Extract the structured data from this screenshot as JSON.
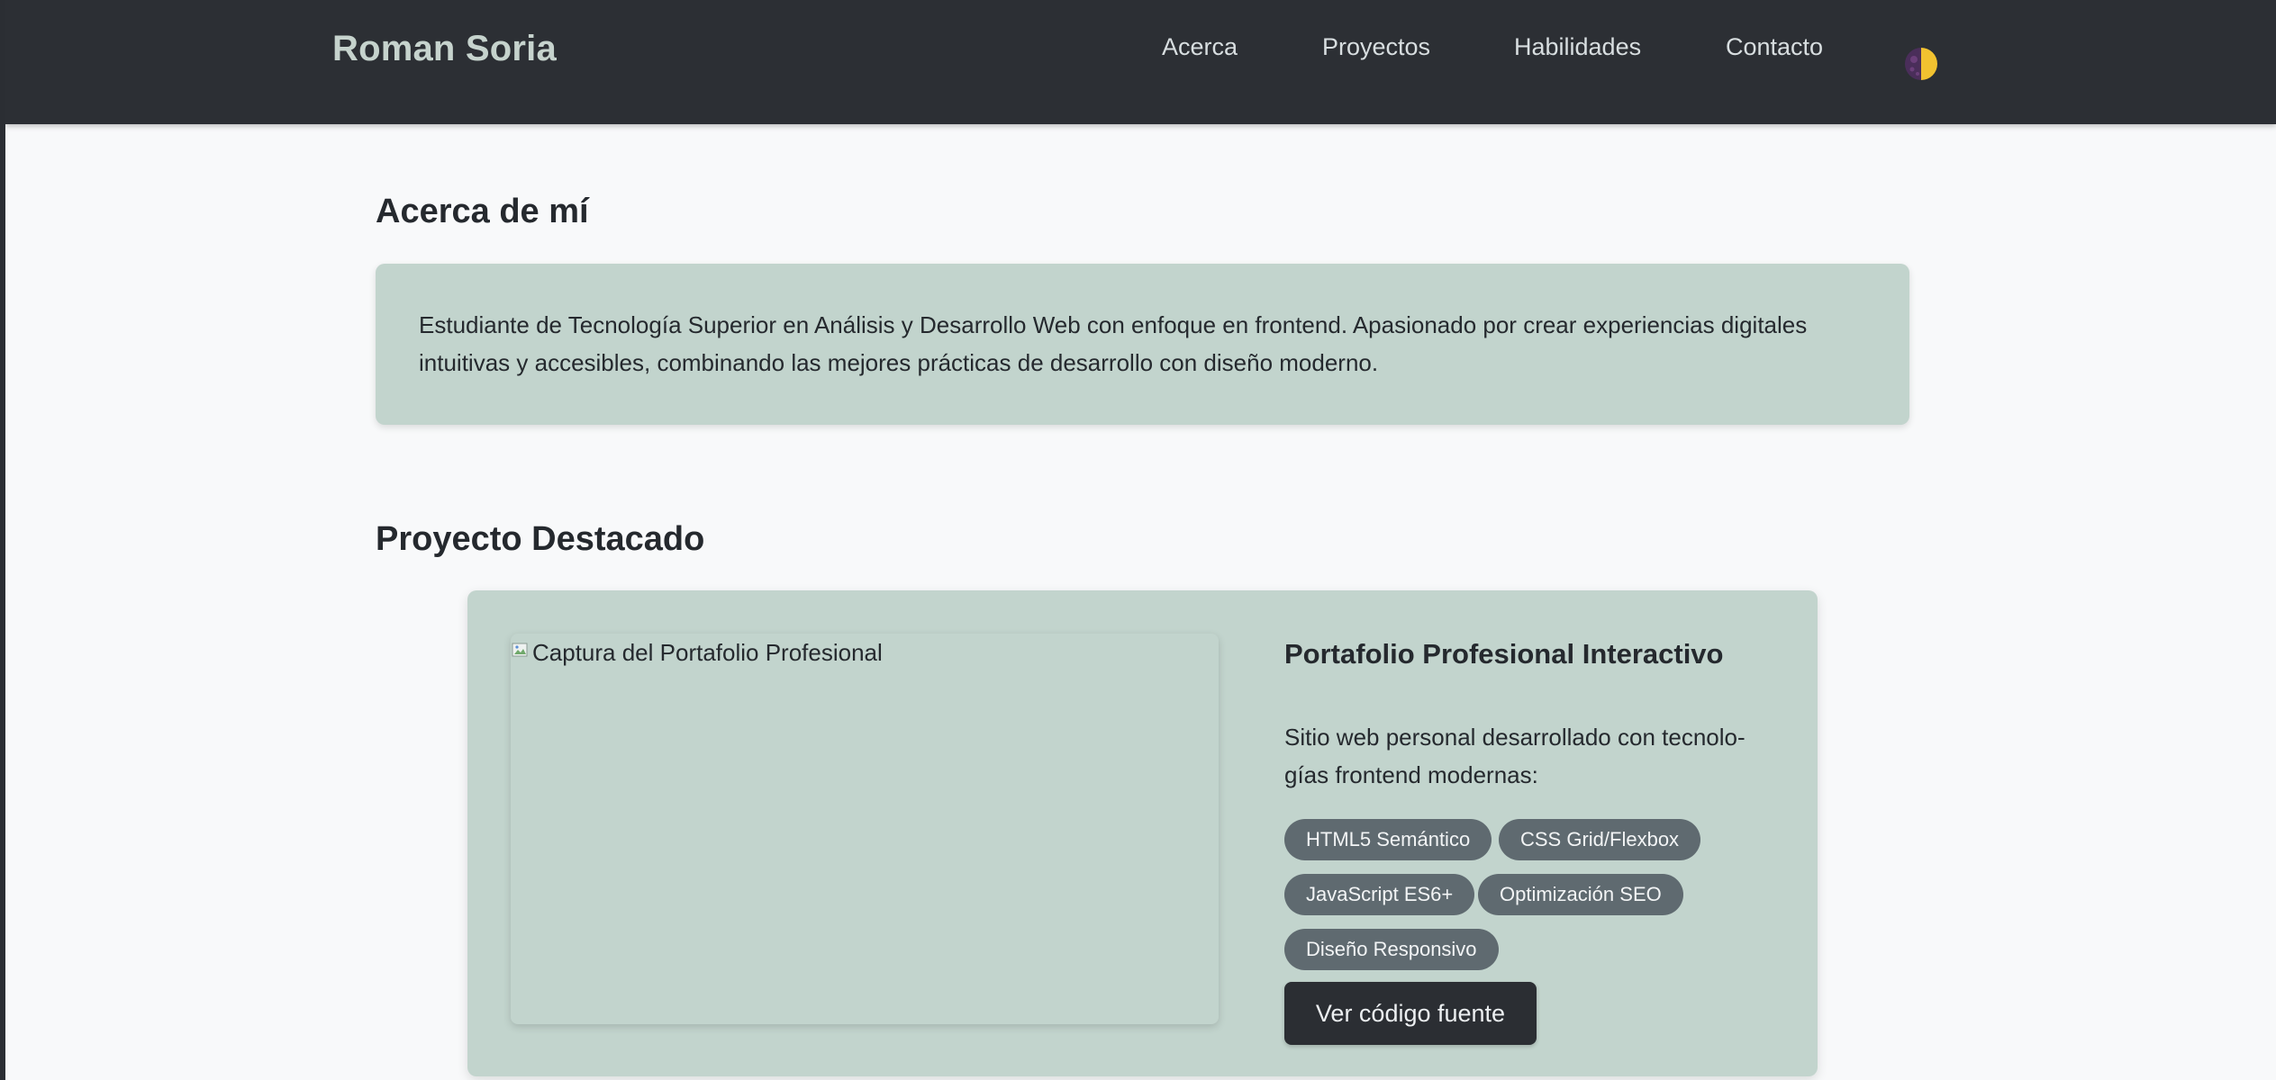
{
  "header": {
    "brand": "Roman Soria",
    "nav": [
      {
        "label": "Acerca"
      },
      {
        "label": "Proyectos"
      },
      {
        "label": "Habilidades"
      },
      {
        "label": "Contacto"
      }
    ],
    "theme_toggle_icon": "half-moon-theme-icon"
  },
  "about": {
    "title": "Acerca de mí",
    "text": "Estudiante de Tecnología Superior en Análisis y Desarrollo Web con enfoque en frontend. Apasionado por crear experiencias digitales intuitivas y accesibles, combinando las mejores prácticas de desarrollo con diseño moderno."
  },
  "featured": {
    "title": "Proyecto Destacado",
    "image_alt": "Captura del Portafolio Profesional",
    "project_title": "Portafolio Profesional Interactivo",
    "description": "Sitio web personal desarrollado con tecnolo-gías frontend modernas:",
    "tags": [
      "HTML5 Semántico",
      "CSS Grid/Flexbox",
      "JavaScript ES6+",
      "Optimización SEO",
      "Diseño Responsivo"
    ],
    "button_label": "Ver código fuente"
  },
  "colors": {
    "header_bg": "#2c2f34",
    "card_bg": "#c2d4cd",
    "tag_bg": "#5f6a70",
    "button_bg": "#2b2e33",
    "page_bg": "#f8f9fa",
    "toggle_yellow": "#f2c230",
    "toggle_purple": "#6b3f7a"
  }
}
